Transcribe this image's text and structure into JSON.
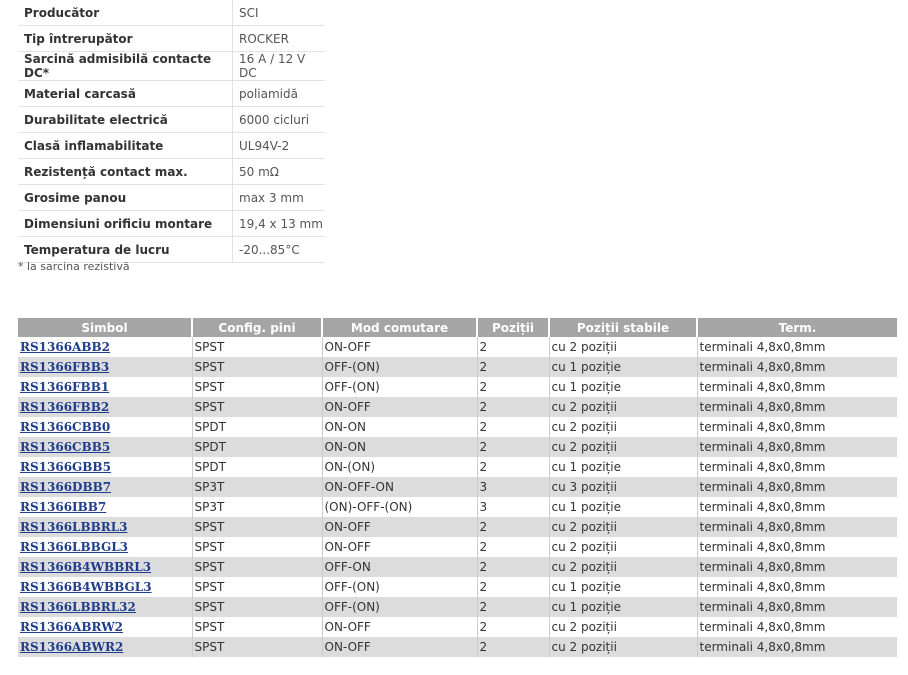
{
  "specs": [
    {
      "label": "Producător",
      "value": "SCI"
    },
    {
      "label": "Tip întrerupător",
      "value": "ROCKER"
    },
    {
      "label": "Sarcină admisibilă contacte DC*",
      "value": "16 A / 12 V DC"
    },
    {
      "label": "Material carcasă",
      "value": "poliamidă"
    },
    {
      "label": "Durabilitate electrică",
      "value": "6000 cicluri"
    },
    {
      "label": "Clasă inflamabilitate",
      "value": "UL94V-2"
    },
    {
      "label": "Rezistență contact max.",
      "value": "50 mΩ"
    },
    {
      "label": "Grosime panou",
      "value": "max 3 mm"
    },
    {
      "label": "Dimensiuni orificiu montare",
      "value": "19,4 x 13 mm"
    },
    {
      "label": "Temperatura de lucru",
      "value": "-20...85°C"
    }
  ],
  "footnote": "* la sarcina rezistivă",
  "products": {
    "headers": [
      "Simbol",
      "Config. pini",
      "Mod comutare",
      "Poziții",
      "Poziții stabile",
      "Term."
    ],
    "rows": [
      [
        "RS1366ABB2",
        "SPST",
        "ON-OFF",
        "2",
        "cu 2 poziții",
        "terminali 4,8x0,8mm"
      ],
      [
        "RS1366FBB3",
        "SPST",
        "OFF-(ON)",
        "2",
        "cu 1 poziție",
        "terminali 4,8x0,8mm"
      ],
      [
        "RS1366FBB1",
        "SPST",
        "OFF-(ON)",
        "2",
        "cu 1 poziție",
        "terminali 4,8x0,8mm"
      ],
      [
        "RS1366FBB2",
        "SPST",
        "ON-OFF",
        "2",
        "cu 2 poziții",
        "terminali 4,8x0,8mm"
      ],
      [
        "RS1366CBB0",
        "SPDT",
        "ON-ON",
        "2",
        "cu 2 poziții",
        "terminali 4,8x0,8mm"
      ],
      [
        "RS1366CBB5",
        "SPDT",
        "ON-ON",
        "2",
        "cu 2 poziții",
        "terminali 4,8x0,8mm"
      ],
      [
        "RS1366GBB5",
        "SPDT",
        "ON-(ON)",
        "2",
        "cu 1 poziție",
        "terminali 4,8x0,8mm"
      ],
      [
        "RS1366DBB7",
        "SP3T",
        "ON-OFF-ON",
        "3",
        "cu 3 poziții",
        "terminali 4,8x0,8mm"
      ],
      [
        "RS1366IBB7",
        "SP3T",
        "(ON)-OFF-(ON)",
        "3",
        "cu 1 poziție",
        "terminali 4,8x0,8mm"
      ],
      [
        "RS1366LBBRL3",
        "SPST",
        "ON-OFF",
        "2",
        "cu 2 poziții",
        "terminali 4,8x0,8mm"
      ],
      [
        "RS1366LBBGL3",
        "SPST",
        "ON-OFF",
        "2",
        "cu 2 poziții",
        "terminali 4,8x0,8mm"
      ],
      [
        "RS1366B4WBBRL3",
        "SPST",
        "OFF-ON",
        "2",
        "cu 2 poziții",
        "terminali 4,8x0,8mm"
      ],
      [
        "RS1366B4WBBGL3",
        "SPST",
        "OFF-(ON)",
        "2",
        "cu 1 poziție",
        "terminali 4,8x0,8mm"
      ],
      [
        "RS1366LBBRL32",
        "SPST",
        "OFF-(ON)",
        "2",
        "cu 1 poziție",
        "terminali 4,8x0,8mm"
      ],
      [
        "RS1366ABRW2",
        "SPST",
        "ON-OFF",
        "2",
        "cu 2 poziții",
        "terminali 4,8x0,8mm"
      ],
      [
        "RS1366ABWR2",
        "SPST",
        "ON-OFF",
        "2",
        "cu 2 poziții",
        "terminali 4,8x0,8mm"
      ]
    ]
  },
  "colors": {
    "header_bg": "#a5a5a5",
    "row_alt_bg": "#dcdcdc",
    "link": "#1f3d8c"
  }
}
